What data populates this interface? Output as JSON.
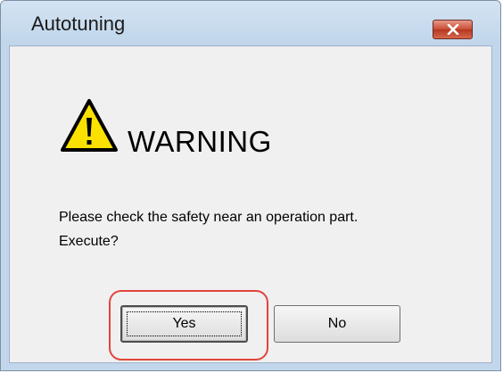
{
  "window": {
    "title": "Autotuning"
  },
  "dialog": {
    "heading": "WARNING",
    "message_line1": "Please check the safety near an operation part.",
    "message_line2": "Execute?"
  },
  "buttons": {
    "yes_label": "Yes",
    "no_label": "No"
  },
  "icons": {
    "warning": "warning-triangle-icon",
    "close": "close-icon"
  },
  "colors": {
    "highlight": "#e2443c",
    "titlebar": "#c2d7ec",
    "close_button": "#c94b33"
  }
}
